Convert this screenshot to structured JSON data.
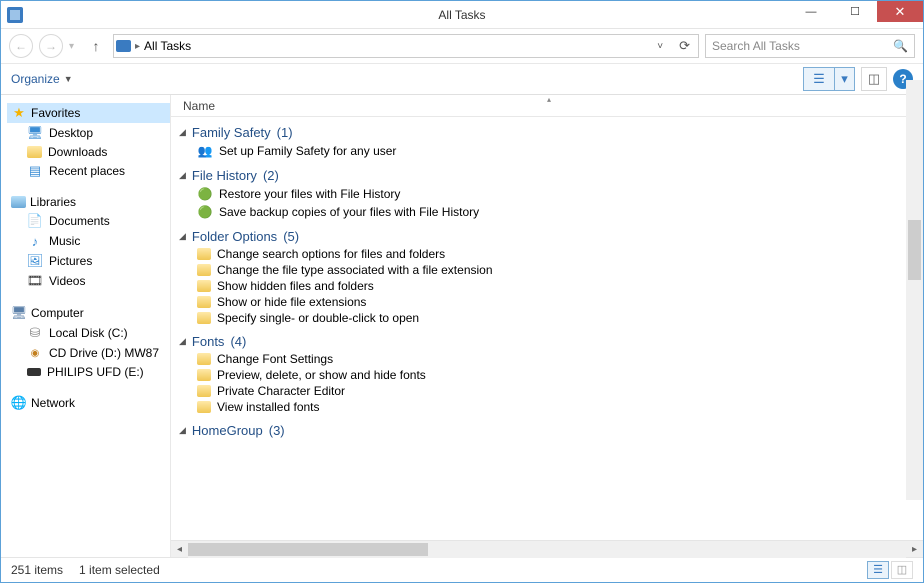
{
  "window": {
    "title": "All Tasks"
  },
  "nav": {
    "breadcrumb": "All Tasks",
    "search_placeholder": "Search All Tasks"
  },
  "toolbar": {
    "organize": "Organize"
  },
  "columns": {
    "name": "Name"
  },
  "sidebar": {
    "favorites": {
      "label": "Favorites",
      "items": [
        {
          "label": "Desktop"
        },
        {
          "label": "Downloads"
        },
        {
          "label": "Recent places"
        }
      ]
    },
    "libraries": {
      "label": "Libraries",
      "items": [
        {
          "label": "Documents"
        },
        {
          "label": "Music"
        },
        {
          "label": "Pictures"
        },
        {
          "label": "Videos"
        }
      ]
    },
    "computer": {
      "label": "Computer",
      "items": [
        {
          "label": "Local Disk (C:)"
        },
        {
          "label": "CD Drive (D:) MW87"
        },
        {
          "label": "PHILIPS UFD (E:)"
        }
      ]
    },
    "network": {
      "label": "Network"
    }
  },
  "groups": [
    {
      "name": "Family Safety",
      "count": "(1)",
      "items": [
        "Set up Family Safety for any user"
      ],
      "icon": "people"
    },
    {
      "name": "File History",
      "count": "(2)",
      "items": [
        "Restore your files with File History",
        "Save backup copies of your files with File History"
      ],
      "icon": "hist"
    },
    {
      "name": "Folder Options",
      "count": "(5)",
      "items": [
        "Change search options for files and folders",
        "Change the file type associated with a file extension",
        "Show hidden files and folders",
        "Show or hide file extensions",
        "Specify single- or double-click to open"
      ],
      "icon": "task"
    },
    {
      "name": "Fonts",
      "count": "(4)",
      "items": [
        "Change Font Settings",
        "Preview, delete, or show and hide fonts",
        "Private Character Editor",
        "View installed fonts"
      ],
      "icon": "task"
    },
    {
      "name": "HomeGroup",
      "count": "(3)",
      "items": [],
      "icon": "task"
    }
  ],
  "status": {
    "total": "251 items",
    "selected": "1 item selected"
  }
}
